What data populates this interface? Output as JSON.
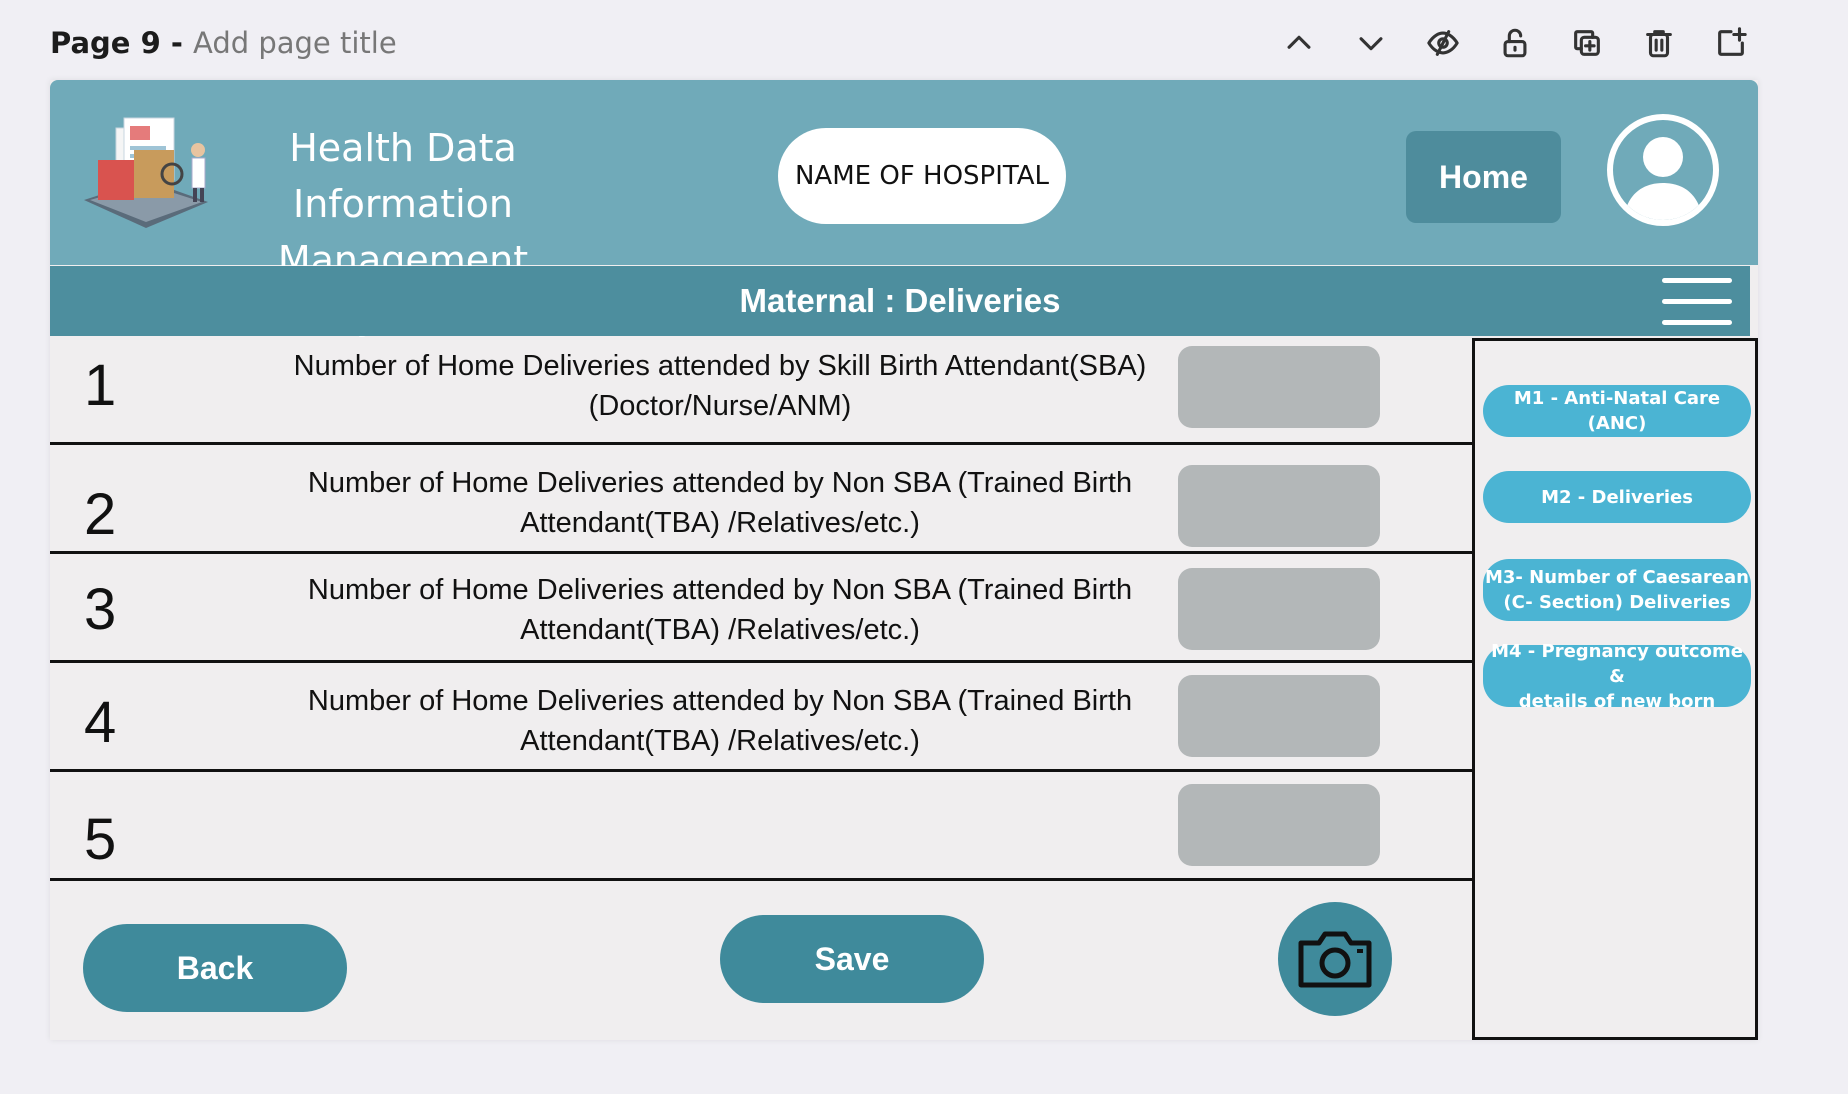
{
  "editor": {
    "page_number": "Page 9",
    "separator": " - ",
    "page_title_placeholder": "Add page title",
    "tools": [
      "chevron-up-icon",
      "chevron-down-icon",
      "eye-slash-icon",
      "unlock-icon",
      "duplicate-icon",
      "trash-icon",
      "add-page-icon"
    ]
  },
  "header": {
    "title_line1": "Health Data Information",
    "title_line2": "Management System",
    "hospital": "NAME OF HOSPITAL",
    "home_label": "Home"
  },
  "section": {
    "title": "Maternal : Deliveries"
  },
  "rows": [
    {
      "num": "1",
      "line1": "Number of Home Deliveries attended by Skill Birth Attendant(SBA)",
      "line2": "(Doctor/Nurse/ANM)"
    },
    {
      "num": "2",
      "line1": "Number of Home Deliveries attended by Non SBA (Trained Birth",
      "line2": "Attendant(TBA) /Relatives/etc.)"
    },
    {
      "num": "3",
      "line1": "Number of Home Deliveries attended by Non SBA (Trained Birth",
      "line2": "Attendant(TBA) /Relatives/etc.)"
    },
    {
      "num": "4",
      "line1": "Number of Home Deliveries attended by Non SBA (Trained Birth",
      "line2": "Attendant(TBA) /Relatives/etc.)"
    },
    {
      "num": "5",
      "line1": "",
      "line2": ""
    }
  ],
  "sidebar": {
    "items": [
      {
        "line1": "M1 - Anti-Natal Care (ANC)",
        "line2": ""
      },
      {
        "line1": "M2 - Deliveries",
        "line2": ""
      },
      {
        "line1": "M3- Number of Caesarean",
        "line2": "(C- Section) Deliveries"
      },
      {
        "line1": "M4 - Pregnancy outcome &",
        "line2": "details of new born"
      }
    ]
  },
  "actions": {
    "back_label": "Back",
    "save_label": "Save"
  },
  "colors": {
    "header": "#70aab9",
    "section_bar": "#4d8e9e",
    "button": "#3f8a9b",
    "sidebar_button": "#4bb4d3",
    "input": "#b3b7b8"
  }
}
